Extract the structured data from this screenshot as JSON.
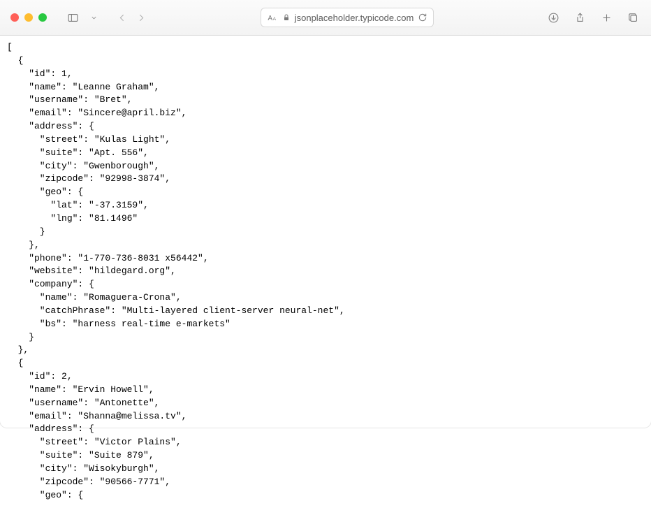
{
  "toolbar": {
    "url": "jsonplaceholder.typicode.com"
  },
  "json_body": [
    {
      "id": 1,
      "name": "Leanne Graham",
      "username": "Bret",
      "email": "Sincere@april.biz",
      "address": {
        "street": "Kulas Light",
        "suite": "Apt. 556",
        "city": "Gwenborough",
        "zipcode": "92998-3874",
        "geo": {
          "lat": "-37.3159",
          "lng": "81.1496"
        }
      },
      "phone": "1-770-736-8031 x56442",
      "website": "hildegard.org",
      "company": {
        "name": "Romaguera-Crona",
        "catchPhrase": "Multi-layered client-server neural-net",
        "bs": "harness real-time e-markets"
      }
    },
    {
      "id": 2,
      "name": "Ervin Howell",
      "username": "Antonette",
      "email": "Shanna@melissa.tv",
      "address": {
        "street": "Victor Plains",
        "suite": "Suite 879",
        "city": "Wisokyburgh",
        "zipcode": "90566-7771",
        "geo": {}
      }
    }
  ],
  "rendered_text": "[\n  {\n    \"id\": 1,\n    \"name\": \"Leanne Graham\",\n    \"username\": \"Bret\",\n    \"email\": \"Sincere@april.biz\",\n    \"address\": {\n      \"street\": \"Kulas Light\",\n      \"suite\": \"Apt. 556\",\n      \"city\": \"Gwenborough\",\n      \"zipcode\": \"92998-3874\",\n      \"geo\": {\n        \"lat\": \"-37.3159\",\n        \"lng\": \"81.1496\"\n      }\n    },\n    \"phone\": \"1-770-736-8031 x56442\",\n    \"website\": \"hildegard.org\",\n    \"company\": {\n      \"name\": \"Romaguera-Crona\",\n      \"catchPhrase\": \"Multi-layered client-server neural-net\",\n      \"bs\": \"harness real-time e-markets\"\n    }\n  },\n  {\n    \"id\": 2,\n    \"name\": \"Ervin Howell\",\n    \"username\": \"Antonette\",\n    \"email\": \"Shanna@melissa.tv\",\n    \"address\": {\n      \"street\": \"Victor Plains\",\n      \"suite\": \"Suite 879\",\n      \"city\": \"Wisokyburgh\",\n      \"zipcode\": \"90566-7771\",\n      \"geo\": {"
}
